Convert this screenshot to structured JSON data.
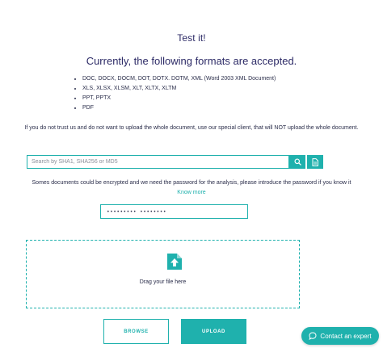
{
  "header": {
    "title": "Test it!",
    "subtitle": "Currently, the following formats are accepted."
  },
  "formats": [
    "DOC, DOCX, DOCM, DOT, DOTX. DOTM, XML (Word 2003 XML Document)",
    "XLS, XLSX, XLSM, XLT, XLTX, XLTM",
    "PPT, PPTX",
    "PDF"
  ],
  "notice": "If you do not trust us and do not want to upload the whole document, use our special client, that will NOT upload the whole document.",
  "search": {
    "placeholder": "Search by SHA1, SHA256 or MD5",
    "search_icon": "search-icon",
    "doc_icon": "document-icon"
  },
  "encrypted": {
    "text": "Somes documents could be encrypted and we need the password for the analysis, please introduce the password if you know it",
    "link": "Know more"
  },
  "password": {
    "value": "••••••••• ••••••••"
  },
  "dropzone": {
    "icon": "file-upload-icon",
    "text": "Drag your file here"
  },
  "buttons": {
    "browse": "BROWSE",
    "upload": "UPLOAD"
  },
  "contact": {
    "label": "Contact an expert",
    "icon": "chat-bubble-icon"
  },
  "colors": {
    "accent": "#1fb1ad",
    "heading": "#2c2a66",
    "text": "#2a2d4a"
  }
}
